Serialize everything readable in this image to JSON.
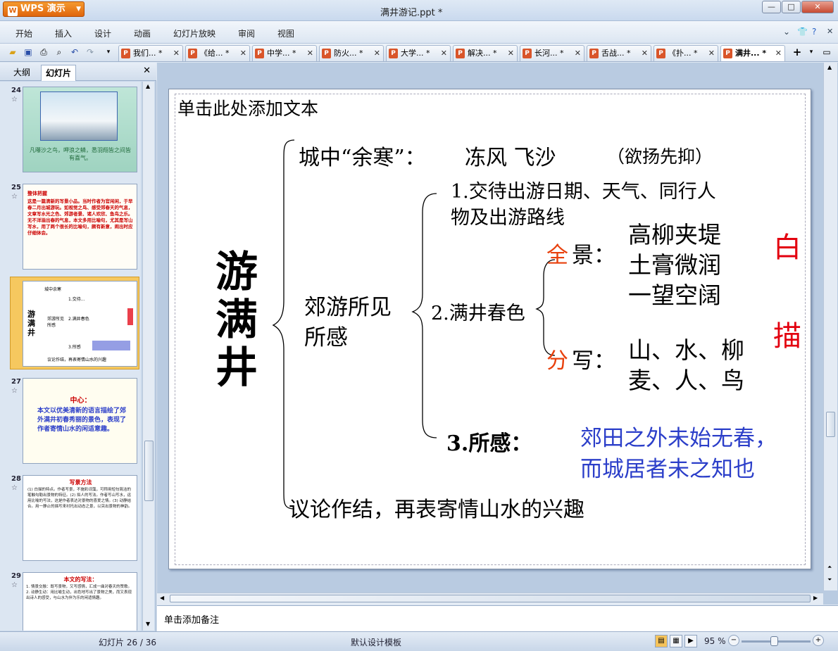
{
  "app": {
    "name": "WPS 演示",
    "window_title": "满井游记.ppt *"
  },
  "window_controls": {
    "minimize": "—",
    "maximize": "□",
    "close": "✕"
  },
  "menu": [
    "开始",
    "插入",
    "设计",
    "动画",
    "幻灯片放映",
    "审阅",
    "视图"
  ],
  "doc_tabs": [
    "我们... *",
    "《给... *",
    "中学... *",
    "防火... *",
    "大学... *",
    "解决... *",
    "长河... *",
    "舌战... *",
    "《扑... *",
    "满井... *"
  ],
  "left_panel": {
    "tabs": [
      "大纲",
      "幻灯片"
    ],
    "active_tab": "幻灯片"
  },
  "thumbnails": [
    {
      "num": "24",
      "caption": "凡曝沙之鸟，呷浪之鳞，悉羽翔皆之间皆有喜气。"
    },
    {
      "num": "25",
      "title": "整体把握",
      "body": "这是一篇清新的写景小品。当时作者为官闲闲，于早春二月出城游玩。如视觉之鸟、感受郊春天的气息，文章写水光之色、郊游者景、诸人欢欣、鱼鸟之乐。无不洋溢出春的气息，本文多用比喻句，尤其是写山写水，用了两个很长的比喻句，颇有新意，闹出时应仔细体会。"
    },
    {
      "num": "26",
      "mini_title": "游满井",
      "mini_items": [
        "城中余寒",
        "郊游所见所感",
        "1.交待...",
        "2.满井春色",
        "3.所感",
        "议论作结，再表寄情山水的兴趣"
      ]
    },
    {
      "num": "27",
      "title": "中心：",
      "body": "本文以优美清新的语言描绘了郊外满井初春秀丽的景色，表现了作者寄情山水的闲适意趣。"
    },
    {
      "num": "28",
      "title": "写景方法",
      "body": "(1) 白描的特点。作者写景，不施彩词藻，可称用短句简洁的笔触勾勒出景物的特征。(2) 拟人的写法。作者写山写水，运用比喻的写法，这是作者表达对景物的喜爱之情。(3) 动静结合。用一静止的描写来衬托出动态之景，以突出景物的神韵。"
    },
    {
      "num": "29",
      "title": "本文的写法：",
      "body": "1. 情景交融：既写景物，又写感情，汇成一曲对春天的赞歌。2. 动静生动：用比喻生动，出色地写出了景物之美，而又表现出诗人的感受，与山水为伴为乐的闲适情趣。"
    }
  ],
  "slide": {
    "placeholder": "单击此处添加文本",
    "main_title": "游满井",
    "line_city": "城中“余寒”：",
    "city_detail": "冻风 飞沙",
    "city_note": "（欲扬先抑）",
    "item1": "1.交待出游日期、天气、同行人物及出游路线",
    "item1_line1": "1.交待出游日期、天气、同行人",
    "item1_line2": "物及出游路线",
    "suburb_line1": "郊游所见",
    "suburb_line2": "所感",
    "item2": "2.满井春色",
    "quan": "全",
    "jing": "景：",
    "scene_lines": [
      "高柳夹堤",
      "土膏微润",
      "一望空阔"
    ],
    "fen": "分",
    "xie": "写：",
    "detail_lines": [
      "山、水、柳",
      "麦、人、鸟"
    ],
    "bai": "白",
    "miao": "描",
    "item3": "3.所感：",
    "quote_lines": [
      "郊田之外未始无春，",
      "而城居者未之知也"
    ],
    "conclusion": "议论作结，再表寄情山水的兴趣"
  },
  "notes_placeholder": "单击添加备注",
  "status": {
    "slide_counter": "幻灯片 26 / 36",
    "template": "默认设计模板",
    "zoom": "95 %"
  },
  "colors": {
    "red": "#e3000f",
    "orange": "#e8400c",
    "blue": "#2b3ec9",
    "accent": "#e0650c"
  }
}
